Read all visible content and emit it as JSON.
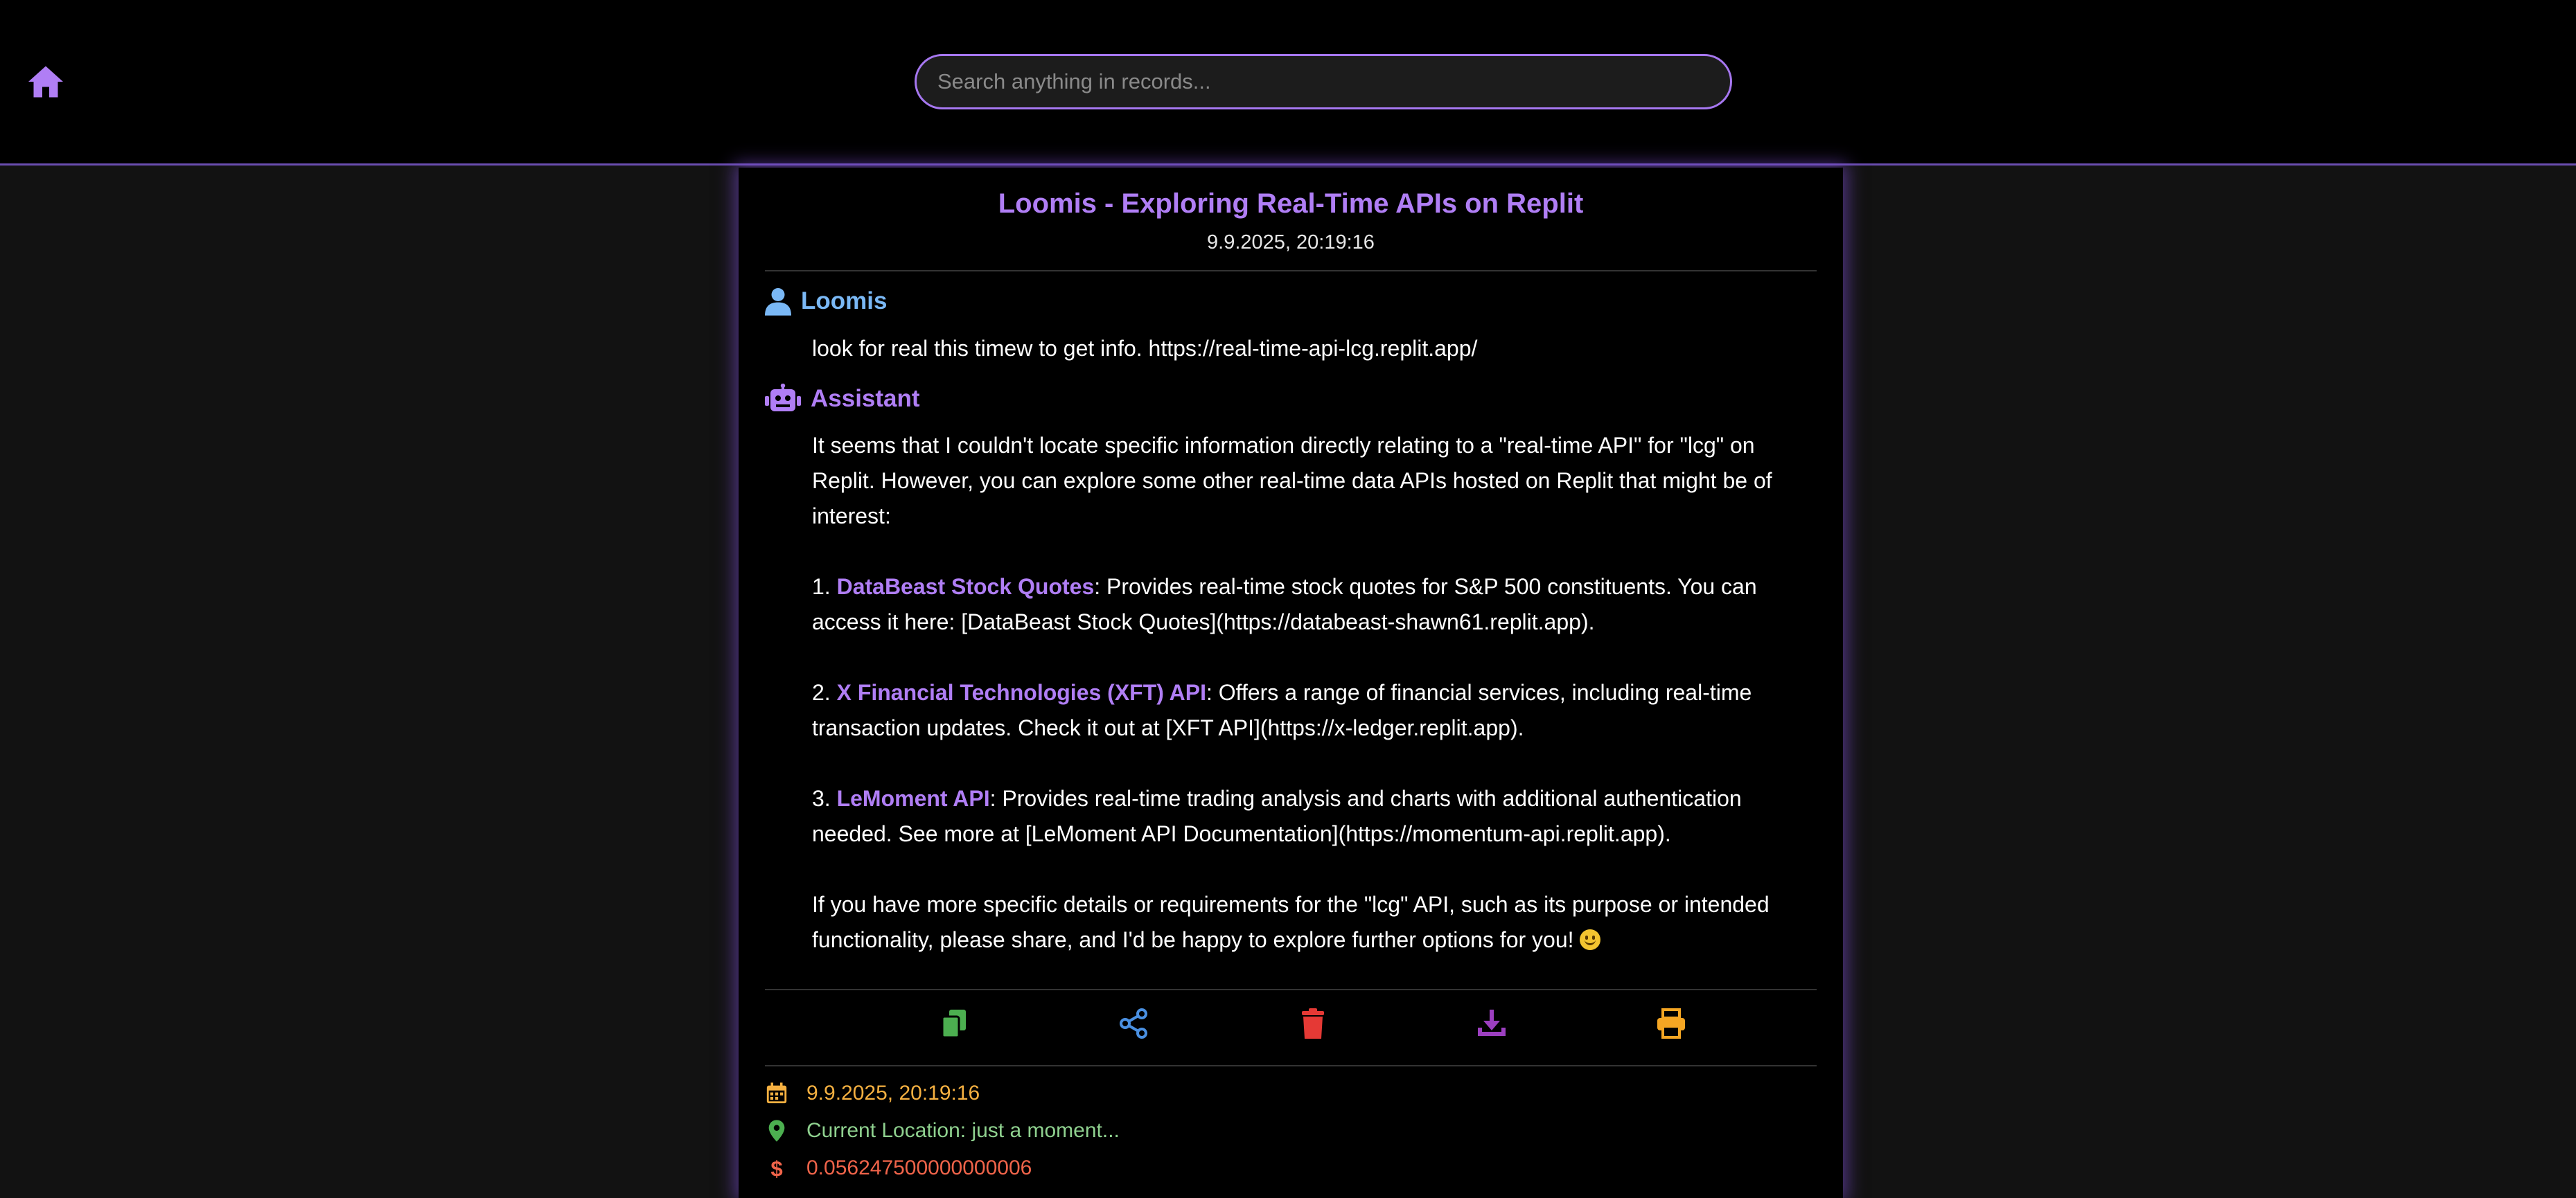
{
  "header": {
    "search_placeholder": "Search anything in records..."
  },
  "record": {
    "title": "Loomis - Exploring Real-Time APIs on Replit",
    "timestamp": "9.9.2025, 20:19:16"
  },
  "user_message": {
    "name": "Loomis",
    "text": "look for real this timew to get info. https://real-time-api-lcg.replit.app/"
  },
  "assistant_message": {
    "name": "Assistant",
    "intro": "It seems that I couldn't locate specific information directly relating to a \"real-time API\" for \"lcg\" on Replit. However, you can explore some other real-time data APIs hosted on Replit that might be of interest:",
    "items": [
      {
        "num": "1. ",
        "name": "DataBeast Stock Quotes",
        "desc": ": Provides real-time stock quotes for S&P 500 constituents. You can access it here: [DataBeast Stock Quotes](https://databeast-shawn61.replit.app)."
      },
      {
        "num": "2. ",
        "name": "X Financial Technologies (XFT) API",
        "desc": ": Offers a range of financial services, including real-time transaction updates. Check it out at [XFT API](https://x-ledger.replit.app)."
      },
      {
        "num": "3. ",
        "name": "LeMoment API",
        "desc": ": Provides real-time trading analysis and charts with additional authentication needed. See more at [LeMoment API Documentation](https://momentum-api.replit.app)."
      }
    ],
    "outro": "If you have more specific details or requirements for the \"lcg\" API, such as its purpose or intended functionality, please share, and I'd be happy to explore further options for you! "
  },
  "meta": {
    "date": "9.9.2025, 20:19:16",
    "location": "Current Location: just a moment...",
    "cost": "0.056247500000000006"
  },
  "icons": {
    "home": "home-icon",
    "user": "user-icon",
    "assistant": "robot-icon",
    "copy": "copy-icon",
    "share": "share-icon",
    "delete": "trash-icon",
    "download": "download-icon",
    "print": "print-icon",
    "calendar": "calendar-icon",
    "location": "location-pin-icon",
    "cost": "dollar-icon"
  },
  "colors": {
    "accent": "#b07ef5",
    "user": "#7ab8f5",
    "copy": "#4caf50",
    "share": "#4a90e2",
    "delete": "#e53935",
    "download": "#9c3fc0",
    "print": "#f5a623",
    "date": "#f5b041",
    "location": "#8fd18f",
    "cost": "#f0644a"
  }
}
